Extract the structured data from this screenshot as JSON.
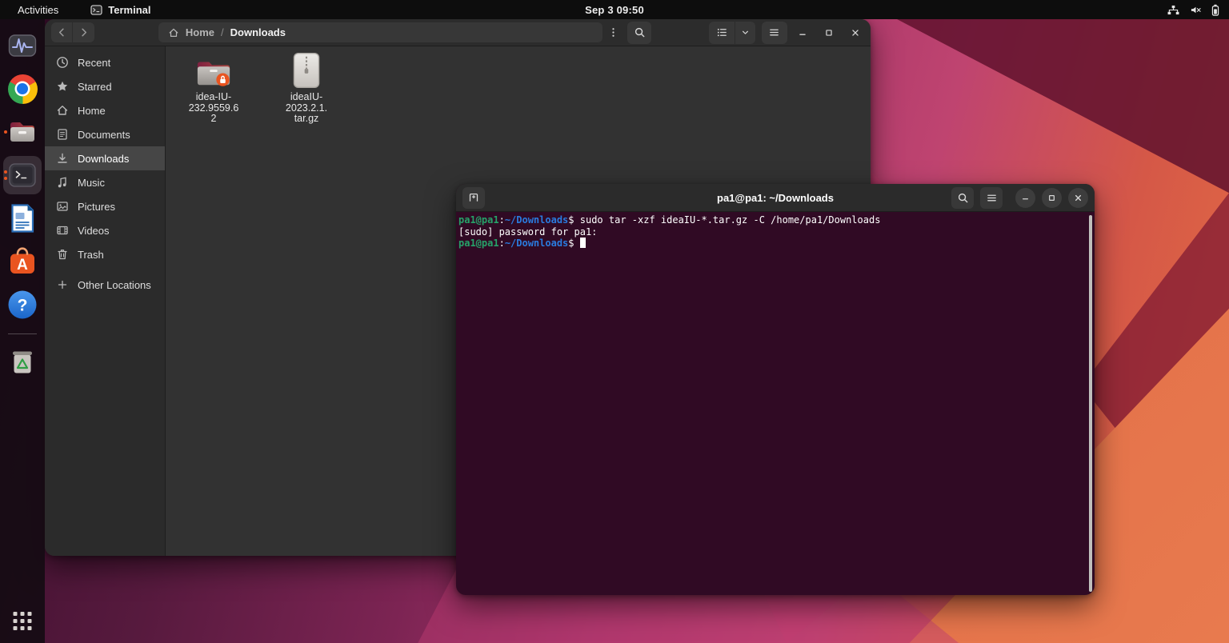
{
  "topbar": {
    "activities_label": "Activities",
    "focused_app": "Terminal",
    "focused_app_icon": "terminal-icon",
    "clock": "Sep 3 09:50",
    "status_icons": [
      "network-wired-icon",
      "audio-muted-icon",
      "battery-icon"
    ]
  },
  "dock": {
    "items": [
      {
        "icon": "system-monitor-icon",
        "indicator_dots": 0,
        "active": false
      },
      {
        "icon": "chrome-icon",
        "indicator_dots": 0,
        "active": false
      },
      {
        "icon": "files-icon",
        "indicator_dots": 1,
        "active": false
      },
      {
        "icon": "terminal-icon",
        "indicator_dots": 2,
        "active": true
      },
      {
        "icon": "libreoffice-writer-icon",
        "indicator_dots": 0,
        "active": false
      },
      {
        "icon": "ubuntu-software-icon",
        "indicator_dots": 0,
        "active": false
      },
      {
        "icon": "help-icon",
        "indicator_dots": 0,
        "active": false
      },
      {
        "icon": "trash-icon",
        "indicator_dots": 0,
        "active": false,
        "after_divider": true
      }
    ],
    "show_apps_icon": "show-applications-icon"
  },
  "files_window": {
    "breadcrumb": {
      "root": "Home",
      "separator": "/",
      "current": "Downloads"
    },
    "sidebar": [
      {
        "icon": "recent-icon",
        "label": "Recent",
        "selected": false
      },
      {
        "icon": "star-icon",
        "label": "Starred",
        "selected": false
      },
      {
        "icon": "home-icon",
        "label": "Home",
        "selected": false
      },
      {
        "icon": "document-icon",
        "label": "Documents",
        "selected": false
      },
      {
        "icon": "download-icon",
        "label": "Downloads",
        "selected": true
      },
      {
        "icon": "music-icon",
        "label": "Music",
        "selected": false
      },
      {
        "icon": "image-icon",
        "label": "Pictures",
        "selected": false
      },
      {
        "icon": "video-icon",
        "label": "Videos",
        "selected": false
      },
      {
        "icon": "trash-icon",
        "label": "Trash",
        "selected": false
      },
      {
        "icon": "plus-icon",
        "label": "Other Locations",
        "selected": false,
        "separated": true
      }
    ],
    "files": [
      {
        "icon": "folder-locked-icon",
        "name": "idea-IU-232.9559.62",
        "label_lines": [
          "idea-IU-",
          "232.9559.6",
          "2"
        ]
      },
      {
        "icon": "archive-icon",
        "name": "ideaIU-2023.2.1.tar.gz",
        "label_lines": [
          "ideaIU-",
          "2023.2.1.",
          "tar.gz"
        ]
      }
    ]
  },
  "terminal_window": {
    "title": "pa1@pa1: ~/Downloads",
    "colors": {
      "background": "#300a24",
      "foreground": "#ffffff",
      "prompt_user": "#26a269",
      "prompt_path": "#2a7bde",
      "cursor": "#ffffff"
    },
    "lines": [
      {
        "segments": [
          {
            "text": "pa1@pa1",
            "style": "user"
          },
          {
            "text": ":",
            "style": "fg"
          },
          {
            "text": "~/Downloads",
            "style": "path"
          },
          {
            "text": "$ sudo tar -xzf ideaIU-*.tar.gz -C /home/pa1/Downloads",
            "style": "fg"
          }
        ],
        "cursor": false
      },
      {
        "segments": [
          {
            "text": "[sudo] password for pa1:",
            "style": "fg"
          }
        ],
        "cursor": false
      },
      {
        "segments": [
          {
            "text": "pa1@pa1",
            "style": "user"
          },
          {
            "text": ":",
            "style": "fg"
          },
          {
            "text": "~/Downloads",
            "style": "path"
          },
          {
            "text": "$ ",
            "style": "fg"
          }
        ],
        "cursor": true
      }
    ]
  },
  "accent_colors": {
    "ubuntu_orange": "#e95420"
  }
}
